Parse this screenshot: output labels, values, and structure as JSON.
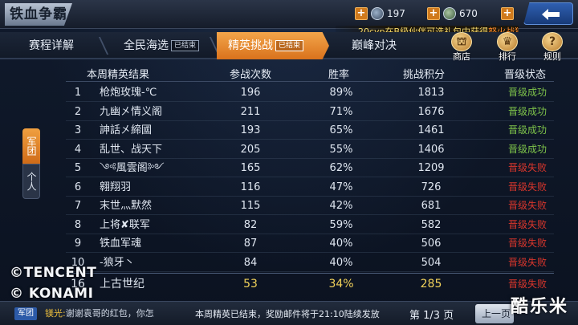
{
  "app": {
    "title": "铁血争霸"
  },
  "resources": [
    {
      "icon": "rank-coin-icon",
      "value": "197"
    },
    {
      "icon": "shield-coin-icon",
      "value": "670"
    }
  ],
  "tabs": [
    {
      "label": "赛程详解",
      "badge": ""
    },
    {
      "label": "全民海选",
      "badge": "已结束"
    },
    {
      "label": "精英挑战",
      "badge": "已结束"
    },
    {
      "label": "巅峰对决",
      "badge": ""
    }
  ],
  "ticker": {
    "prefix": "20cyp在B级伙伴可选礼包中获得",
    "highlight": "怒火战狼碎"
  },
  "side_buttons": [
    {
      "label": "商店",
      "icon": "shop-icon"
    },
    {
      "label": "排行",
      "icon": "ranking-icon"
    },
    {
      "label": "规则",
      "icon": "rules-icon"
    }
  ],
  "side_tab": {
    "active": "军团",
    "inactive": "个人"
  },
  "table": {
    "headers": [
      "本周精英结果",
      "参战次数",
      "胜率",
      "挑战积分",
      "晋级状态"
    ],
    "rows": [
      {
        "rank": "1",
        "name": "枪炮玫瑰-℃",
        "battles": "196",
        "rate": "89%",
        "score": "1813",
        "status": "晋级成功",
        "ok": true
      },
      {
        "rank": "2",
        "name": "九幽㐅情义阁",
        "battles": "211",
        "rate": "71%",
        "score": "1676",
        "status": "晋级成功",
        "ok": true
      },
      {
        "rank": "3",
        "name": "訷話㐅締國",
        "battles": "193",
        "rate": "65%",
        "score": "1461",
        "status": "晋级成功",
        "ok": true
      },
      {
        "rank": "4",
        "name": "乱世、战天下",
        "battles": "205",
        "rate": "55%",
        "score": "1406",
        "status": "晋级成功",
        "ok": true
      },
      {
        "rank": "5",
        "name": "༺風雲阁༻",
        "battles": "165",
        "rate": "62%",
        "score": "1209",
        "status": "晋级失败",
        "ok": false
      },
      {
        "rank": "6",
        "name": "翱翔羽",
        "battles": "116",
        "rate": "47%",
        "score": "726",
        "status": "晋级失败",
        "ok": false
      },
      {
        "rank": "7",
        "name": "末世灬默然",
        "battles": "115",
        "rate": "42%",
        "score": "681",
        "status": "晋级失败",
        "ok": false
      },
      {
        "rank": "8",
        "name": "上将✘联军",
        "battles": "82",
        "rate": "59%",
        "score": "582",
        "status": "晋级失败",
        "ok": false
      },
      {
        "rank": "9",
        "name": "铁血军魂",
        "battles": "87",
        "rate": "40%",
        "score": "506",
        "status": "晋级失败",
        "ok": false
      },
      {
        "rank": "10",
        "name": "-狼牙丶",
        "battles": "84",
        "rate": "40%",
        "score": "504",
        "status": "晋级失败",
        "ok": false
      }
    ],
    "own": {
      "rank": "16",
      "name": "上古世纪",
      "battles": "53",
      "rate": "34%",
      "score": "285",
      "status": "晋级失败"
    }
  },
  "chat": {
    "channel": "军团",
    "sender": "镁光:",
    "message": "谢谢袁哥的红包，你怎"
  },
  "notice": "本周精英已结束，奖励邮件将于21:10陆续发放",
  "pager": {
    "text": "第 1/3 页",
    "prev": "上一页"
  },
  "watermarks": [
    "©TENCENT",
    "© KONAMI"
  ],
  "site_mark": "酷乐米",
  "colors": {
    "accent": "#e8882c",
    "success": "#7ec34a",
    "fail": "#d8362c",
    "highlight": "#f2d25a"
  }
}
